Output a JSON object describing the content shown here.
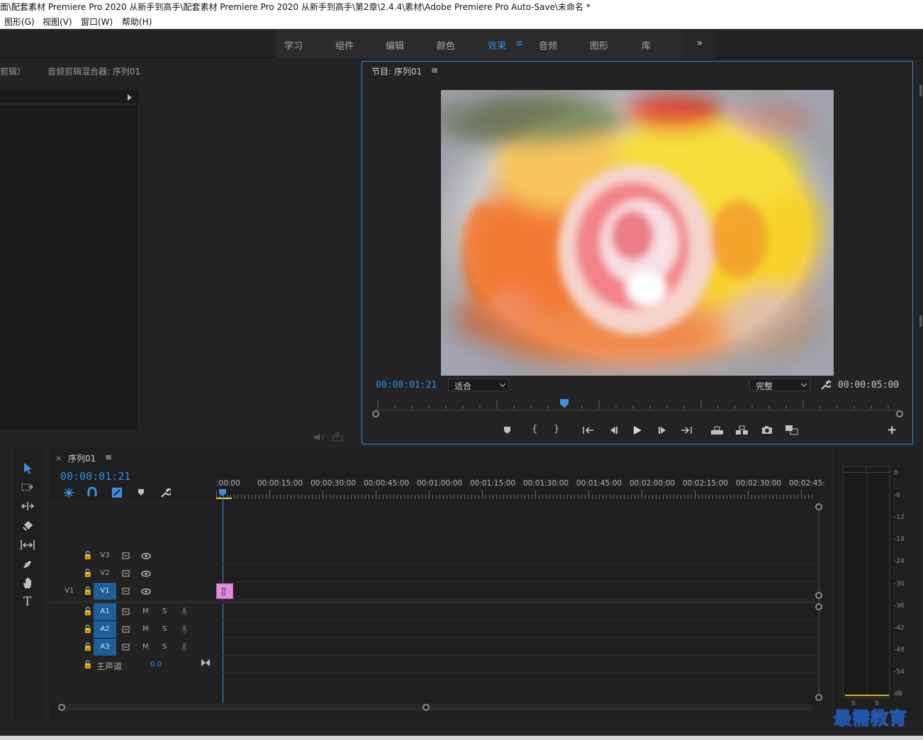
{
  "window": {
    "title": "面\\配套素材 Premiere Pro 2020 从新手到高手\\配套素材 Premiere Pro 2020 从新手到高手\\第2章\\2.4.4\\素材\\Adobe Premiere Pro Auto-Save\\未命名 *"
  },
  "menu": {
    "items": [
      "图形(G)",
      "视图(V)",
      "窗口(W)",
      "帮助(H)"
    ]
  },
  "workspaces": {
    "items": [
      "学习",
      "组件",
      "编辑",
      "颜色",
      "效果",
      "音频",
      "图形",
      "库"
    ],
    "active": "效果",
    "menu_glyph": "≡",
    "more": "»"
  },
  "source_panel": {
    "tab_cut": "剪辑）",
    "tab_mixer": "音频剪辑混合器: 序列01"
  },
  "program": {
    "title": "节目: 序列01",
    "menu_glyph": "≡",
    "timecode": "00:00:01:21",
    "fit": "适合",
    "quality": "完整",
    "duration": "00:00:05:00",
    "playhead_fraction": 0.36
  },
  "timeline": {
    "tab_close": "×",
    "tab": "序列01",
    "menu_glyph": "≡",
    "timecode": "00:00:01:21",
    "ruler": [
      ":00:00",
      "00:00:15:00",
      "00:00:30:00",
      "00:00:45:00",
      "00:01:00:00",
      "00:01:15:00",
      "00:01:30:00",
      "00:01:45:00",
      "00:02:00:00",
      "00:02:15:00",
      "00:02:30:00",
      "00:02:45:"
    ],
    "video_tracks": [
      {
        "name": "V3",
        "src": ""
      },
      {
        "name": "V2",
        "src": ""
      },
      {
        "name": "V1",
        "src": "V1"
      }
    ],
    "audio_tracks": [
      {
        "name": "A1"
      },
      {
        "name": "A2"
      },
      {
        "name": "A3"
      }
    ],
    "mute": "M",
    "solo": "S",
    "master_label": "主声道",
    "master_value": "0.0"
  },
  "meter": {
    "labels": [
      "0",
      "-6",
      "-12",
      "-18",
      "-24",
      "-30",
      "-36",
      "-42",
      "-48",
      "-54",
      "dB"
    ],
    "solo": [
      "S",
      "S"
    ]
  },
  "watermark": "最需教育",
  "colors": {
    "accent": "#2d8ceb",
    "clip": "#e38be0",
    "track_active": "#1f5f99"
  }
}
